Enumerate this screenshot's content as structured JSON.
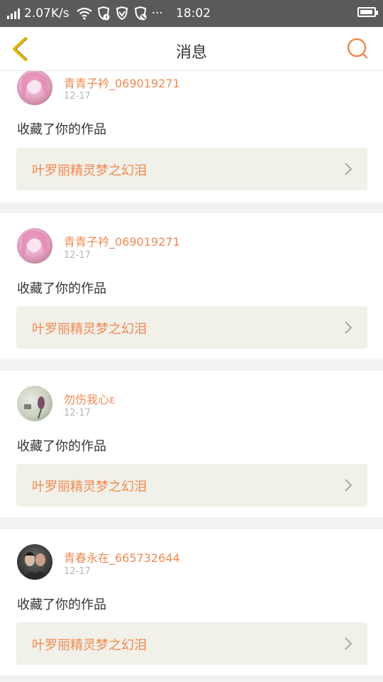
{
  "status_bar": {
    "net_speed": "2.07K/s",
    "time": "18:02",
    "dots": "···"
  },
  "nav": {
    "title": "消息"
  },
  "messages": [
    {
      "username": "青青子衿_069019271",
      "date": "12-17",
      "action": "收藏了你的作品",
      "work_title": "叶罗丽精灵梦之幻泪"
    },
    {
      "username": "青青子衿_069019271",
      "date": "12-17",
      "action": "收藏了你的作品",
      "work_title": "叶罗丽精灵梦之幻泪"
    },
    {
      "username": "勿伤我心ε",
      "date": "12-17",
      "action": "收藏了你的作品",
      "work_title": "叶罗丽精灵梦之幻泪"
    },
    {
      "username": "青春永在_665732644",
      "date": "12-17",
      "action": "收藏了你的作品",
      "work_title": "叶罗丽精灵梦之幻泪"
    }
  ],
  "colors": {
    "accent": "#f08a52",
    "back_arrow": "#e6b800",
    "status_bar_bg": "#5a5a5a"
  }
}
